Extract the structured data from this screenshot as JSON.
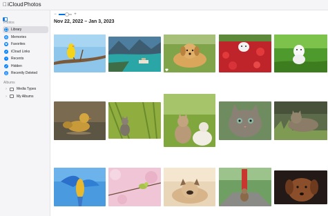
{
  "window": {
    "app_title": "iCloud Photos",
    "brand_name": "iCloud",
    "brand_section": "Photos"
  },
  "sidebar": {
    "photos_heading": "Photos",
    "items": [
      {
        "label": "Library",
        "icon": "library-icon",
        "active": true
      },
      {
        "label": "Memories",
        "icon": "memories-icon"
      },
      {
        "label": "Favorites",
        "icon": "heart-icon"
      },
      {
        "label": "iCloud Links",
        "icon": "link-icon"
      },
      {
        "label": "Recents",
        "icon": "clock-icon"
      },
      {
        "label": "Hidden",
        "icon": "eye-slash-icon"
      },
      {
        "label": "Recently Deleted",
        "icon": "trash-icon"
      }
    ],
    "albums_heading": "Albums",
    "albums": [
      {
        "label": "Media Types",
        "icon": "album-icon"
      },
      {
        "label": "My Albums",
        "icon": "album-icon"
      }
    ]
  },
  "toolbar": {
    "zoom_out": "−",
    "zoom_in": "+",
    "zoom_level": 0.65
  },
  "library": {
    "date_range": "Nov 22, 2022 – Jan 3, 2023",
    "photos": [
      {
        "subject": "yellow bird on branch"
      },
      {
        "subject": "lake with mountains and boat"
      },
      {
        "subject": "puppy lying on grass",
        "favorite": true
      },
      {
        "subject": "white dog in red flowers"
      },
      {
        "subject": "white fluffy dog on grass"
      },
      {
        "subject": "ducklings in water"
      },
      {
        "subject": "kitten in grass"
      },
      {
        "subject": "two kittens in meadow"
      },
      {
        "subject": "tabby cat close-up"
      },
      {
        "subject": "tabby cat lying in grass"
      },
      {
        "subject": "blue macaw flying"
      },
      {
        "subject": "small bird on blossom branch"
      },
      {
        "subject": "french bulldog lying down"
      },
      {
        "subject": "dog near red lighthouse"
      },
      {
        "subject": "brown dog in dark"
      }
    ]
  },
  "colors": {
    "accent": "#0071e3",
    "sidebar_bg": "#f5f5f7",
    "selected_bg": "#dedee2"
  }
}
